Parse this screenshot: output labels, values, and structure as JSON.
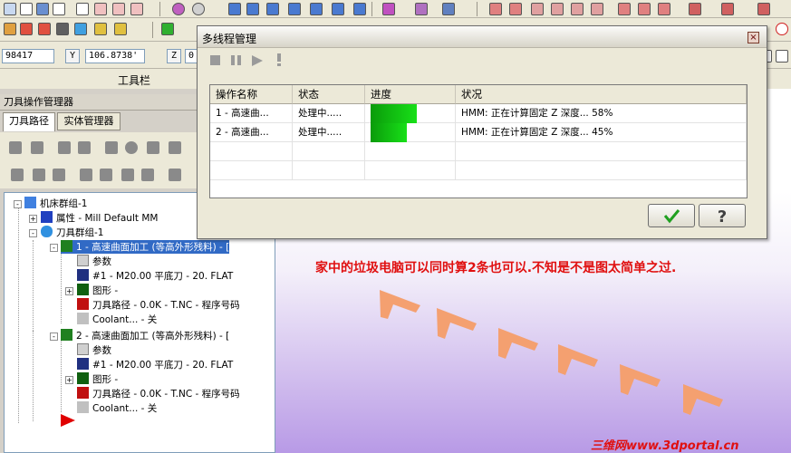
{
  "coords": {
    "x_value": "98417",
    "y_label": "Y",
    "y_value": "106.8738'",
    "z_label": "Z",
    "z_value": "0"
  },
  "toolbar_label": "工具栏",
  "panel": {
    "title": "刀具操作管理器",
    "tabs": [
      "刀具路径",
      "实体管理器"
    ]
  },
  "tree": {
    "root": "机床群组-1",
    "props": "属性 - Mill Default MM",
    "group": "刀具群组-1",
    "op1": "1 - 高速曲面加工 (等高外形残料) - [",
    "op1_params": "参数",
    "op1_tool": "#1 - M20.00 平底刀 -     20. FLAT",
    "op1_geom": "图形 -",
    "op1_path": "刀具路径 - 0.0K - T.NC - 程序号码",
    "op1_coolant": "Coolant... - 关",
    "op2": "2 - 高速曲面加工 (等高外形残料) - [",
    "op2_params": "参数",
    "op2_tool": "#1 - M20.00 平底刀 -     20. FLAT",
    "op2_geom": "图形 -",
    "op2_path": "刀具路径 - 0.0K - T.NC - 程序号码",
    "op2_coolant": "Coolant... - 关"
  },
  "dialog": {
    "title": "多线程管理",
    "close": "×",
    "columns": [
      "操作名称",
      "状态",
      "进度",
      "状况"
    ],
    "rows": [
      {
        "name": "1 - 高速曲...",
        "status": "处理中.....",
        "progress": 0.58,
        "info": "HMM:  正在计算固定 Z 深度... 58%"
      },
      {
        "name": "2 - 高速曲...",
        "status": "处理中.....",
        "progress": 0.45,
        "info": "HMM:  正在计算固定 Z 深度... 45%"
      }
    ]
  },
  "caption": "家中的垃圾电脑可以同时算2条也可以.不知是不是图太简单之过.",
  "watermark": "三维网www.3dportal.cn",
  "colors": {
    "accent": "#e01010",
    "progress": "#14c814",
    "shape": "#f4a070"
  }
}
